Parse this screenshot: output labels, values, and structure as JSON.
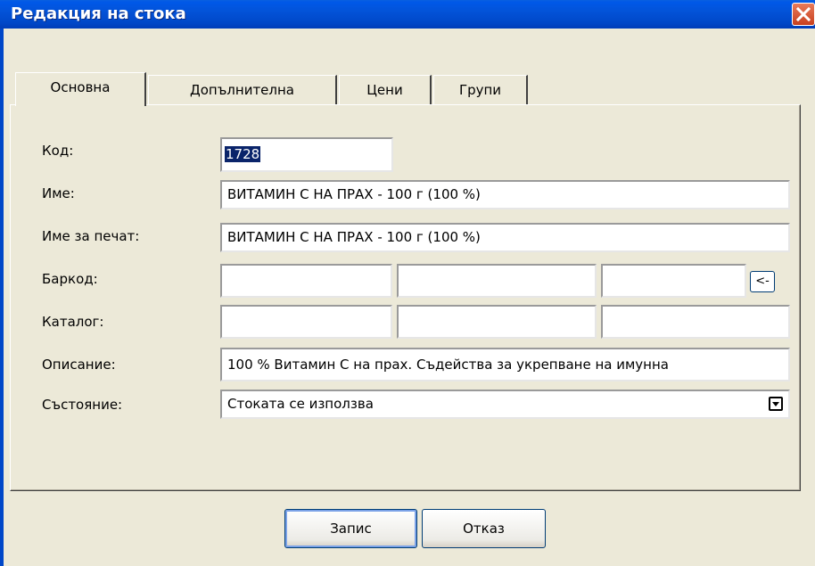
{
  "window": {
    "title": "Редакция на стока"
  },
  "tabs": [
    {
      "label": "Основна",
      "active": true
    },
    {
      "label": "Допълнителна",
      "active": false
    },
    {
      "label": "Цени",
      "active": false
    },
    {
      "label": "Групи",
      "active": false
    }
  ],
  "form": {
    "code": {
      "label": "Код:",
      "value": "1728"
    },
    "name": {
      "label": "Име:",
      "value": "ВИТАМИН С НА ПРАХ - 100 г (100 %)"
    },
    "print_name": {
      "label": "Име за печат:",
      "value": "ВИТАМИН С НА ПРАХ - 100 г (100 %)"
    },
    "barcode": {
      "label": "Баркод:",
      "values": [
        "",
        "",
        ""
      ],
      "button_label": "<-"
    },
    "catalog": {
      "label": "Каталог:",
      "values": [
        "",
        "",
        ""
      ]
    },
    "description": {
      "label": "Описание:",
      "value": "100 %  Витамин С на прах. Съдейства за укрепване на имунна"
    },
    "status": {
      "label": "Състояние:",
      "value": "Стоката се използва"
    }
  },
  "buttons": {
    "save": "Запис",
    "cancel": "Отказ"
  },
  "colors": {
    "titlebar": "#0353D8",
    "window_bg": "#ECE9D8",
    "selection": "#0A246A",
    "close": "#C8401E"
  }
}
